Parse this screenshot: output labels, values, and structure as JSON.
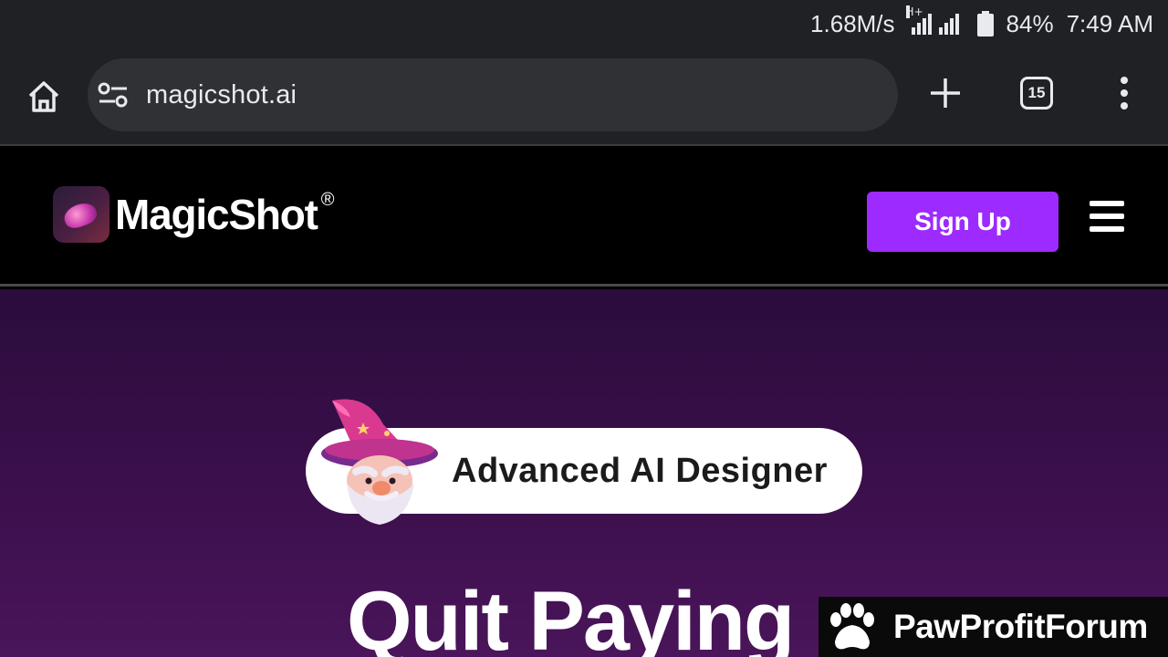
{
  "status_bar": {
    "net_speed": "1.68M/s",
    "network_type": "H+",
    "battery": "84%",
    "time": "7:49 AM"
  },
  "browser": {
    "url": "magicshot.ai",
    "tab_count": "15",
    "icons": [
      "home-icon",
      "site-settings-icon",
      "plus-icon",
      "tab-switcher-icon",
      "more-menu-icon"
    ]
  },
  "site_header": {
    "logo_text": "MagicShot",
    "logo_reg": "®",
    "signup_label": "Sign Up",
    "accent_color": "#9d2bff"
  },
  "hero": {
    "badge_text": "Advanced AI Designer",
    "heading": "Quit Paying"
  },
  "watermark": {
    "text": "PawProfitForum"
  }
}
